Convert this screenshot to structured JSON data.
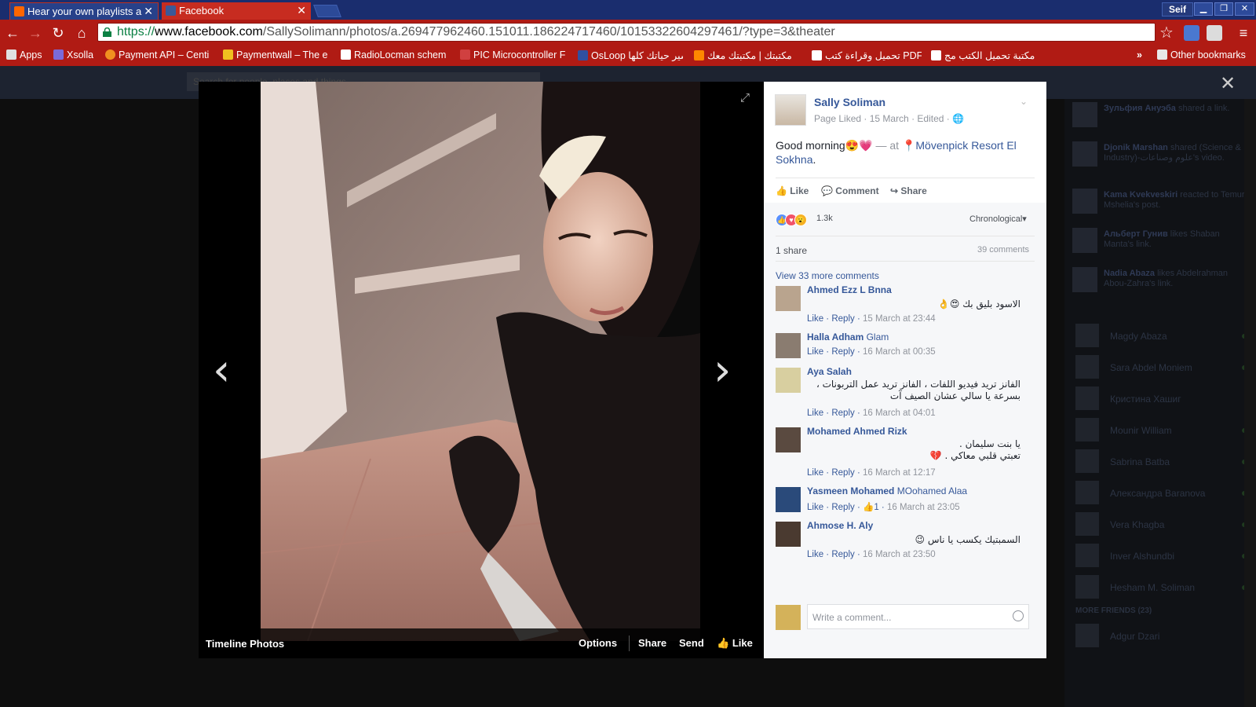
{
  "browser": {
    "tabs": [
      {
        "title": "Hear your own playlists a",
        "color": "#ff6600"
      },
      {
        "title": "Facebook",
        "color": "#3b5998"
      }
    ],
    "user": "Seif",
    "url_scheme": "https://",
    "url_host": "www.facebook.com",
    "url_path": "/SallySolimann/photos/a.269477962460.151011.186224717460/10153322604297461/?type=3&theater",
    "bookmarks": [
      {
        "label": "Apps",
        "icon": "apps-grid-icon",
        "color": "#e0e0e0"
      },
      {
        "label": "Xsolla",
        "icon": "xsolla-icon",
        "color": "#7b6ad8"
      },
      {
        "label": "Payment API – Centi",
        "icon": "payment-icon",
        "color": "#f09020"
      },
      {
        "label": "Paymentwall – The e",
        "icon": "paymentwall-icon",
        "color": "#f0c020"
      },
      {
        "label": "RadioLocman schem",
        "icon": "rl-icon",
        "color": "#ffffff"
      },
      {
        "label": "PIC Microcontroller F",
        "icon": "pic-icon",
        "color": "#d04040"
      },
      {
        "label": "OsLoop سير حياتك كلها",
        "icon": "osloop-icon",
        "color": "#3050a0"
      },
      {
        "label": "مكتبتك | مكتبتك معك",
        "icon": "blogger-icon",
        "color": "#ff8800"
      },
      {
        "label": "تحميل وقراءة كتب PDF",
        "icon": "book-icon",
        "color": "#ffffff"
      },
      {
        "label": "مكتبة تحميل الكتب مج",
        "icon": "download-icon",
        "color": "#ffffff"
      }
    ],
    "more_bookmarks": "»",
    "other_bookmarks": "Other bookmarks"
  },
  "facebook": {
    "search_placeholder": "Search for people, places and things",
    "sidebar_activity": [
      {
        "name": "Зульфия Ануэба",
        "text": "shared a link."
      },
      {
        "name": "Djonik Marshan",
        "text": "shared (Science & Industry)-علوم وصناعات's video."
      },
      {
        "name": "Kama Kvekveskiri",
        "text": "reacted to Temur Mshelia's post."
      },
      {
        "name": "Альберт Гунив",
        "text": "likes Shaban Manta's link."
      },
      {
        "name": "Nadia Abaza",
        "text": "likes Abdelrahman Abou-Zahra's link."
      }
    ],
    "sidebar_chat": [
      "Magdy Abaza",
      "Sara Abdel Moniem",
      "Кристина Хашиг",
      "Mounir William",
      "Sabrina Batba",
      "Александра Baranova",
      "Vera Khagba",
      "Inver Alshundbi",
      "Hesham M. Soliman"
    ],
    "more_friends": "MORE FRIENDS (23)",
    "more_friends_name": "Adgur Dzari"
  },
  "photo_viewer": {
    "album_label": "Timeline Photos",
    "actions": [
      "Options",
      "Share",
      "Send",
      "Like"
    ]
  },
  "post": {
    "author": "Sally Soliman",
    "meta": "Page Liked · 15 March · Edited ·",
    "text": "Good morning😍💗",
    "at_label": "— at",
    "location": "Mövenpick Resort El Sokhna",
    "actions": {
      "like": "Like",
      "comment": "Comment",
      "share": "Share"
    },
    "reaction_count": "1.3k",
    "sort": "Chronological",
    "shares": "1 share",
    "comments_count": "39 comments",
    "view_more": "View 33 more comments",
    "comments": [
      {
        "name": "Ahmed Ezz L Bnna",
        "tag": "",
        "body": [
          "الاسود بليق بك 😍👌"
        ],
        "meta_like": "Like",
        "meta_reply": "Reply",
        "likes": "",
        "date": "15 March at 23:44"
      },
      {
        "name": "Halla Adham",
        "tag": "Glam",
        "body": [],
        "meta_like": "Like",
        "meta_reply": "Reply",
        "likes": "",
        "date": "16 March at 00:35"
      },
      {
        "name": "Aya Salah",
        "tag": "",
        "body": [
          "الفانز تريد فيديو اللفات ، الفانز تريد عمل التربونات ،",
          "بسرعة يا سالي عشان الصيف آت"
        ],
        "meta_like": "Like",
        "meta_reply": "Reply",
        "likes": "",
        "date": "16 March at 04:01"
      },
      {
        "name": "Mohamed Ahmed Rizk",
        "tag": "",
        "body": [
          "يا بنت سليمان .",
          "تعبتي قلبي معاكي . 💔"
        ],
        "meta_like": "Like",
        "meta_reply": "Reply",
        "likes": "",
        "date": "16 March at 12:17"
      },
      {
        "name": "Yasmeen Mohamed",
        "tag": "MOohamed Alaa",
        "body": [],
        "meta_like": "Like",
        "meta_reply": "Reply",
        "likes": "1",
        "date": "16 March at 23:05"
      },
      {
        "name": "Ahmose H. Aly",
        "tag": "",
        "body": [
          "السمبتيك يكسب يا ناس 😉"
        ],
        "meta_like": "Like",
        "meta_reply": "Reply",
        "likes": "",
        "date": "16 March at 23:50"
      }
    ],
    "write_placeholder": "Write a comment..."
  }
}
